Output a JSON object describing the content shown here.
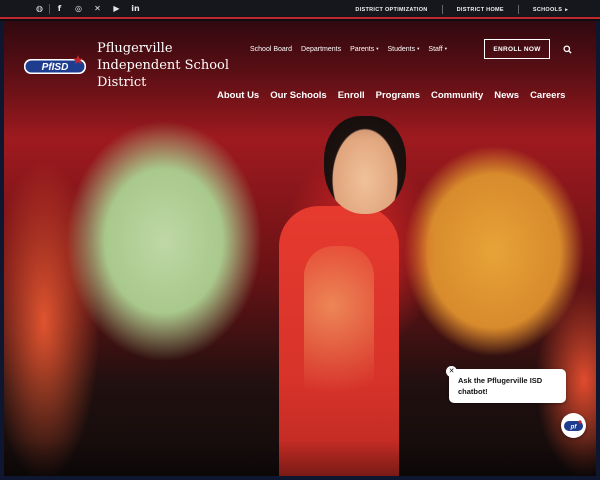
{
  "topbar": {
    "social": [
      {
        "name": "website-icon",
        "glyph": "◍"
      },
      {
        "name": "facebook-icon",
        "glyph": "f"
      },
      {
        "name": "instagram-icon",
        "glyph": "◎"
      },
      {
        "name": "x-icon",
        "glyph": "✕"
      },
      {
        "name": "youtube-icon",
        "glyph": "▶"
      },
      {
        "name": "linkedin-icon",
        "glyph": "in"
      }
    ],
    "links": {
      "optimization": "DISTRICT OPTIMIZATION",
      "home": "DISTRICT HOME",
      "schools": "SCHOOLS",
      "schools_caret": "▸"
    }
  },
  "header": {
    "logo_text": "PfISD",
    "name_line1": "Pflugerville",
    "name_line2": "Independent School",
    "name_line3": "District"
  },
  "nav_secondary": {
    "school_board": "School Board",
    "departments": "Departments",
    "parents": "Parents",
    "students": "Students",
    "staff": "Staff",
    "caret": "▾",
    "enroll": "ENROLL NOW"
  },
  "nav_primary": {
    "about": "About Us",
    "schools": "Our Schools",
    "enroll": "Enroll",
    "programs": "Programs",
    "community": "Community",
    "news": "News",
    "careers": "Careers"
  },
  "chatbot": {
    "line1": "Ask the Pflugerville ISD",
    "line2": "chatbot!",
    "close": "✕"
  },
  "colors": {
    "accent_red": "#c1272d",
    "topbar_bg": "#15171c",
    "brand_blue": "#1f3d8f"
  }
}
